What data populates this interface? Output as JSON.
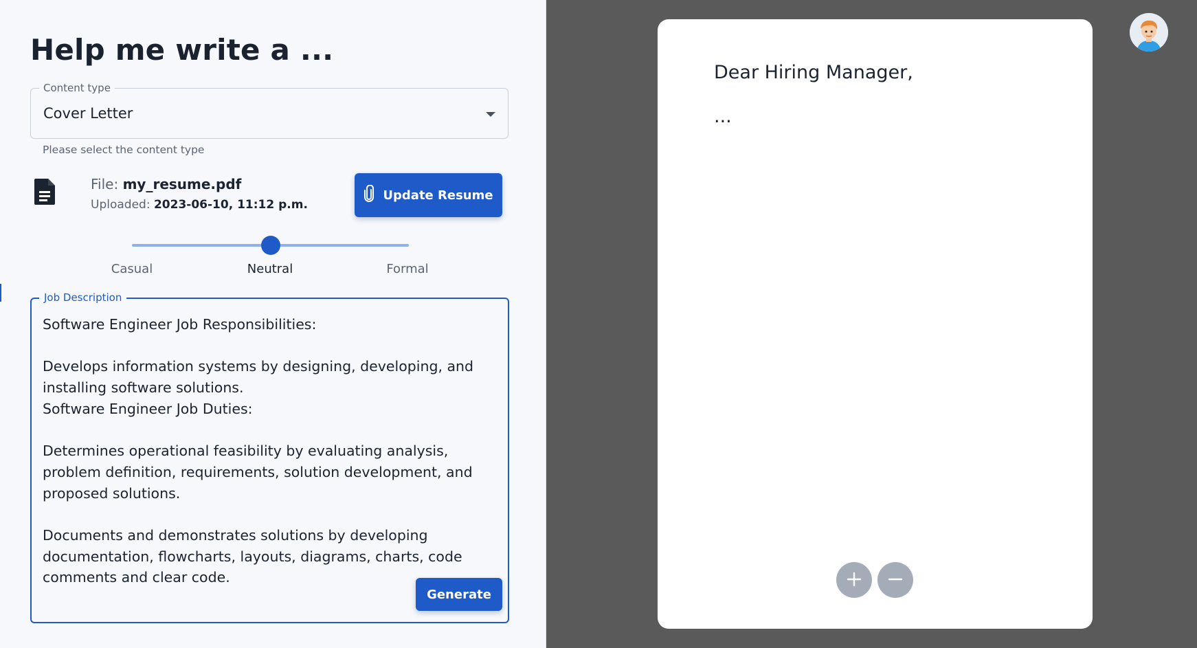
{
  "page": {
    "heading": "Help me write a ..."
  },
  "content_type": {
    "legend": "Content type",
    "value": "Cover Letter",
    "helper": "Please select the content type"
  },
  "file": {
    "file_label": "File:",
    "file_name": "my_resume.pdf",
    "uploaded_label": "Uploaded:",
    "uploaded_value": "2023-06-10, 11:12 p.m.",
    "update_button": "Update Resume"
  },
  "tone": {
    "options": [
      "Casual",
      "Neutral",
      "Formal"
    ],
    "selected": "Neutral",
    "position": 0.5
  },
  "job": {
    "legend": "Job Description",
    "text": "Software Engineer Job Responsibilities:\n\nDevelops information systems by designing, developing, and installing software solutions.\nSoftware Engineer Job Duties:\n\nDetermines operational feasibility by evaluating analysis, problem definition, requirements, solution development, and proposed solutions.\n\nDocuments and demonstrates solutions by developing documentation, flowcharts, layouts, diagrams, charts, code comments and clear code.",
    "generate_button": "Generate"
  },
  "document": {
    "greeting": "Dear Hiring Manager,",
    "body": "..."
  },
  "icons": {
    "file": "file-document-icon",
    "attach": "paperclip-icon",
    "zoom_in": "plus-icon",
    "zoom_out": "minus-icon",
    "avatar": "user-avatar"
  },
  "colors": {
    "primary": "#1f5bc8",
    "left_panel_bg": "#f6f8fb",
    "right_panel_bg": "#5a5a5a",
    "zoom_button": "#a4acb8"
  }
}
